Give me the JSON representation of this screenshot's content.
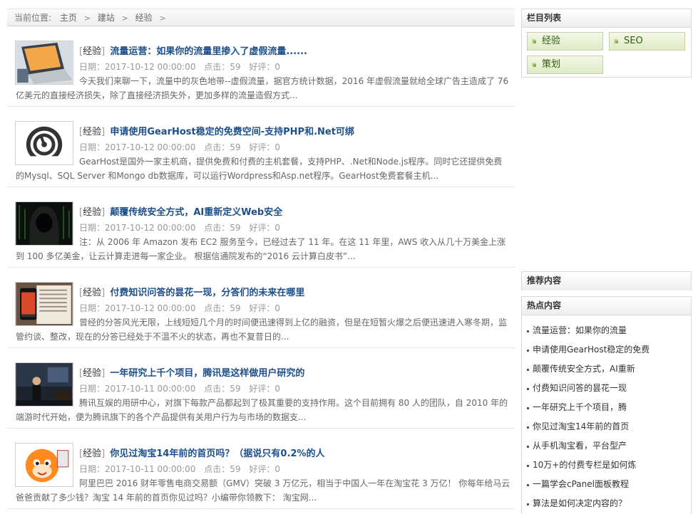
{
  "breadcrumb": {
    "label": "当前位置:",
    "items": [
      "主页",
      "建站",
      "经验"
    ],
    "sep": ">"
  },
  "posts": [
    {
      "category": "经验",
      "title": "流量运营：如果你的流量里掺入了虚假流量......",
      "date": "日期：2017-10-12 00:00:00",
      "clicks": "点击：59",
      "comments": "好评：0",
      "excerpt1": "今天我们来聊一下，流量中的灰色地带--虚假流量，据官方统计数据，2016 年虚假流量就给全球广告主造成了 76",
      "excerpt2": "亿美元的直接经济损失，除了直接经济损失外，更加多样的流量造假方式...",
      "thumb_icon": "laptop-icon"
    },
    {
      "category": "经验",
      "title": "申请使用GearHost稳定的免费空间-支持PHP和.Net可绑",
      "date": "日期：2017-10-12 00:00:00",
      "clicks": "点击：59",
      "comments": "好评：0",
      "excerpt1": "GearHost是国外一家主机商，提供免费和付费的主机套餐，支持PHP、.Net和Node.js程序。同时它还提供免费",
      "excerpt2": "的Mysql、SQL Server 和Mongo db数据库，可以运行Wordpress和Asp.net程序。GearHost免费套餐主机...",
      "thumb_icon": "speedometer-icon"
    },
    {
      "category": "经验",
      "title": "颠覆传统安全方式，AI重新定义Web安全",
      "date": "日期：2017-10-12 00:00:00",
      "clicks": "点击：59",
      "comments": "好评：0",
      "excerpt1": "注：从 2006 年 Amazon 发布 EC2 服务至今，已经过去了 11 年。在这 11 年里，AWS 收入从几十万美金上涨",
      "excerpt2": "到 100 多亿美金，让云计算走进每一家企业。 根据信通院发布的“2016 云计算白皮书”...",
      "thumb_icon": "hooded-hacker-icon"
    },
    {
      "category": "经验",
      "title": "付费知识问答的昙花一现，分答们的未来在哪里",
      "date": "日期：2017-10-12 00:00:00",
      "clicks": "点击：59",
      "comments": "好评：0",
      "excerpt1": "曾经的分答风光无限，上线短短几个月的时间便迅速得到上亿的融资，但是在短暂火爆之后便迅速进入寒冬期，监",
      "excerpt2": "管约谈、整改，现在的分答已经处于不温不火的状态，再也不复昔日的...",
      "thumb_icon": "phone-magazine-icon"
    },
    {
      "category": "经验",
      "title": "一年研究上千个项目，腾讯是这样做用户研究的",
      "date": "日期：2017-10-11 00:00:00",
      "clicks": "点击：59",
      "comments": "好评：0",
      "excerpt1": "腾讯互娱的用研中心，对旗下每款产品都起到了极其重要的支持作用。这个目前拥有 80 人的团队，自 2010 年的",
      "excerpt2": "端游时代开始，便为腾讯旗下的各个产品提供有关用户行为与市场的数据支...",
      "thumb_icon": "stage-speaker-icon"
    },
    {
      "category": "经验",
      "title": "你见过淘宝14年前的首页吗？（据说只有0.2%的人",
      "date": "日期：2017-10-11 00:00:00",
      "clicks": "点击：59",
      "comments": "好评：0",
      "excerpt1": "阿里巴巴 2016 财年零售电商交易额（GMV）突破 3 万亿元，相当于中国人一年在淘宝花 3 万亿！ 你每年给马云",
      "excerpt2": "爸爸贡献了多少钱？淘宝 14 年前的首页你见过吗？小编带你领教下： 淘宝网...",
      "thumb_icon": "taobao-mascot-icon"
    }
  ],
  "sidebar": {
    "categories_title": "栏目列表",
    "categories": [
      "经验",
      "SEO",
      "策划"
    ],
    "recommended_title": "推荐内容",
    "hot_title": "热点内容",
    "hot_items": [
      "流量运营：如果你的流量",
      "申请使用GearHost稳定的免费",
      "颠覆传统安全方式，AI重新",
      "付费知识问答的昙花一现",
      "一年研究上千个项目，腾",
      "你见过淘宝14年前的首页",
      "从手机淘宝看，平台型产",
      "10万+的付费专栏是如何炼",
      "一篇学会cPanel面板教程",
      "算法是如何决定内容的？"
    ]
  }
}
